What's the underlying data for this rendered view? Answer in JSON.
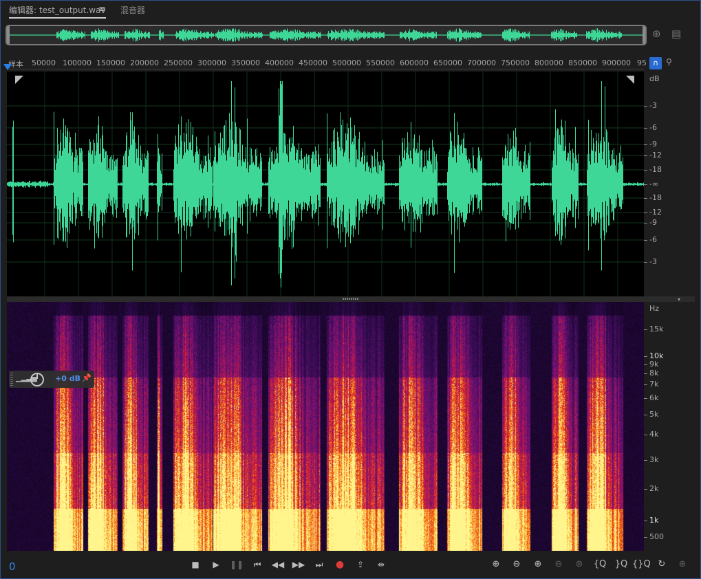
{
  "tabs": {
    "editor": "编辑器: test_output.wav",
    "mixer": "混音器",
    "menu_icon": "menu-icon"
  },
  "ruler": {
    "unit_label": "样本",
    "ticks": [
      "50000",
      "100000",
      "150000",
      "200000",
      "250000",
      "300000",
      "350000",
      "400000",
      "450000",
      "500000",
      "550000",
      "600000",
      "650000",
      "700000",
      "750000",
      "800000",
      "850000",
      "900000",
      "95"
    ]
  },
  "waveform_scale": {
    "unit": "dB",
    "labels": [
      "-3",
      "-6",
      "-9",
      "-12",
      "-18",
      "-∞",
      "-18",
      "-12",
      "-9",
      "-6",
      "-3"
    ]
  },
  "spectral_scale": {
    "unit": "Hz",
    "labels": [
      "15k",
      "10k",
      "9k",
      "8k",
      "7k",
      "6k",
      "5k",
      "4k",
      "3k",
      "2k",
      "1k",
      "500"
    ]
  },
  "hud": {
    "level": "+0 dB"
  },
  "timecode": "0",
  "colors": {
    "waveform": "#3fd797",
    "accent": "#2680eb",
    "record": "#e03a3a"
  },
  "transport": {
    "buttons": [
      "stop-icon",
      "play-icon",
      "pause-icon",
      "skip-to-start-icon",
      "rewind-icon",
      "fast-forward-icon",
      "skip-to-end-icon",
      "record-icon",
      "loop-icon",
      "skip-selection-icon"
    ]
  },
  "zoom": {
    "buttons": [
      "zoom-in-amplitude-icon",
      "zoom-out-amplitude-icon",
      "zoom-in-time-icon",
      "zoom-out-time-icon",
      "zoom-reset-icon",
      "zoom-in-selection-icon",
      "zoom-out-selection-icon",
      "zoom-full-icon",
      "zoom-to-selection-icon",
      "zoom-playhead-icon"
    ]
  }
}
